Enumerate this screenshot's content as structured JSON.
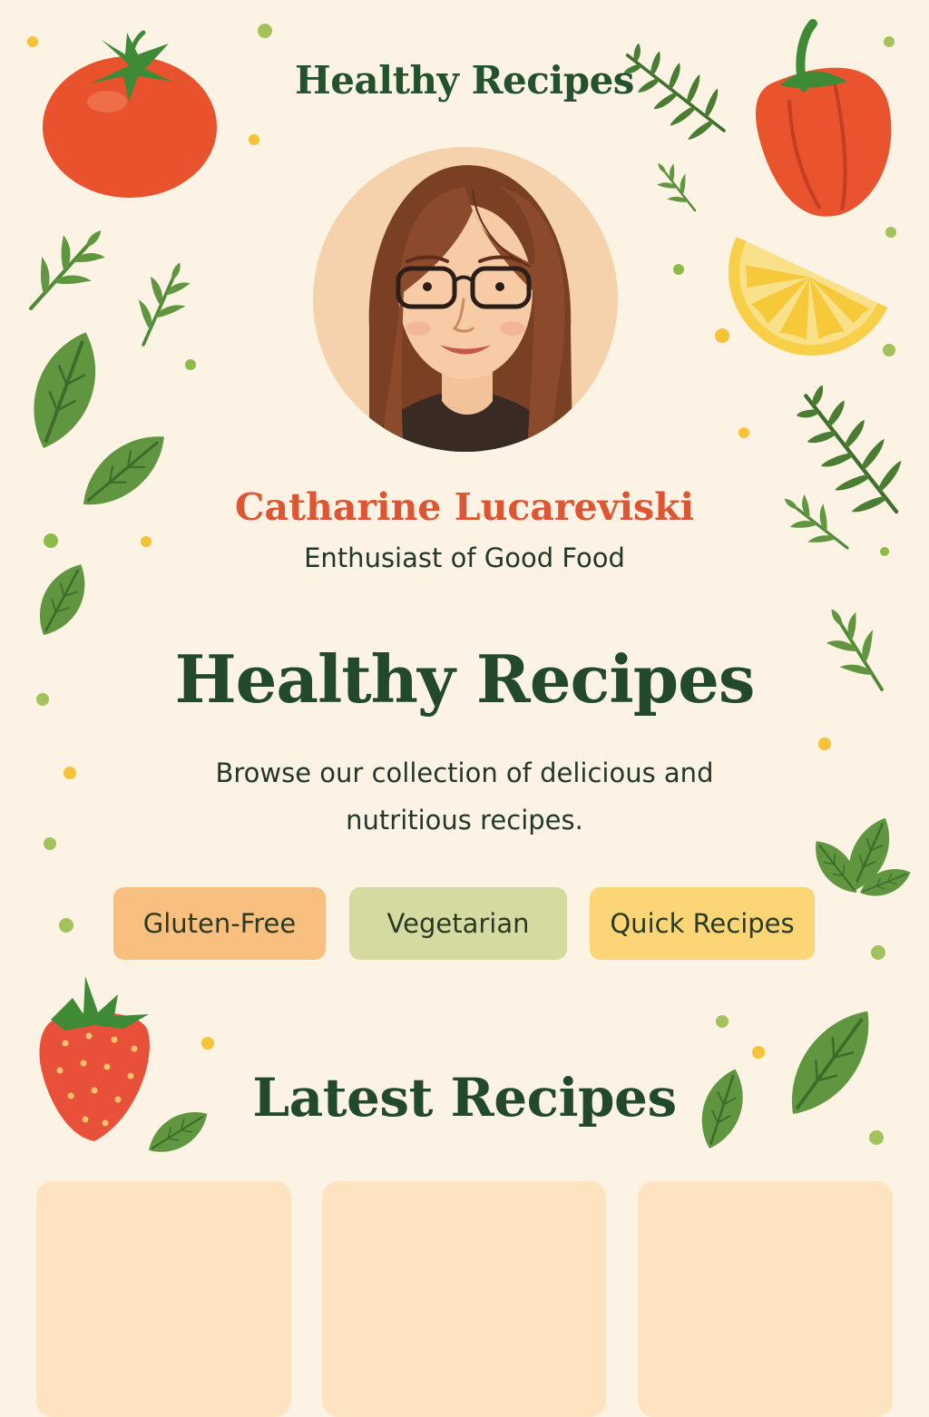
{
  "header": {
    "site_title": "Healthy Recipes"
  },
  "profile": {
    "name": "Catharine Lucareviski",
    "tagline": "Enthusiast of Good Food"
  },
  "hero": {
    "title": "Healthy Recipes",
    "description": "Browse our collection of delicious and nutritious recipes."
  },
  "filters": [
    {
      "label": "Gluten-Free",
      "color": "#f8bf7f"
    },
    {
      "label": "Vegetarian",
      "color": "#d5dba0"
    },
    {
      "label": "Quick Recipes",
      "color": "#fcd577"
    }
  ],
  "latest": {
    "title": "Latest Recipes",
    "card_count": 3
  },
  "colors": {
    "background": "#fcf3e4",
    "heading_green": "#21492a",
    "accent_orange": "#dd5533",
    "card_fill": "#fde3c0"
  },
  "decorations": [
    "tomato-icon",
    "bell-pepper-icon",
    "lemon-slice-icon",
    "strawberry-icon",
    "spinach-leaf-icon",
    "herb-sprig-icon"
  ]
}
